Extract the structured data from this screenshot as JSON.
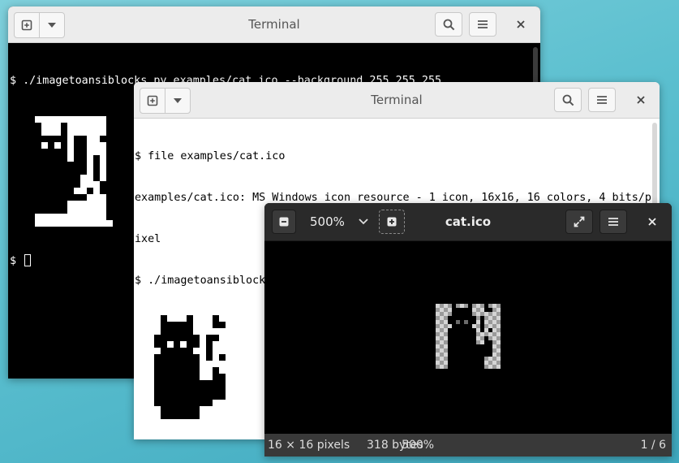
{
  "terminal1": {
    "title": "Terminal",
    "lines": [
      "$ ./imagetoansiblocks.py examples/cat.ico --background 255 255 255"
    ],
    "prompt": "$ "
  },
  "terminal2": {
    "title": "Terminal",
    "lines": [
      "$ file examples/cat.ico",
      "examples/cat.ico: MS Windows icon resource - 1 icon, 16x16, 16 colors, 4 bits/p",
      "ixel",
      "$ ./imagetoansiblocks.py examples/cat.ico"
    ],
    "prompt": "$ "
  },
  "viewer": {
    "title": "cat.ico",
    "zoom": "500%",
    "status": {
      "dimensions": "16 × 16 pixels",
      "size": "318 bytes",
      "zoom": "500%",
      "page": "1 / 6"
    }
  },
  "icons": {
    "new_tab": "new-tab-icon",
    "dropdown": "chevron-down-icon",
    "search": "search-icon",
    "menu": "hamburger-menu-icon",
    "close": "close-icon",
    "zoom_out": "zoom-out-icon",
    "zoom_in": "zoom-in-icon",
    "fullscreen": "fullscreen-icon"
  },
  "colors": {
    "desktop": "#5bbfcf",
    "terminal1_bg": "#000000",
    "terminal1_fg": "#ffffff",
    "terminal2_bg": "#ffffff",
    "terminal2_fg": "#000000",
    "viewer_bg": "#000000"
  }
}
